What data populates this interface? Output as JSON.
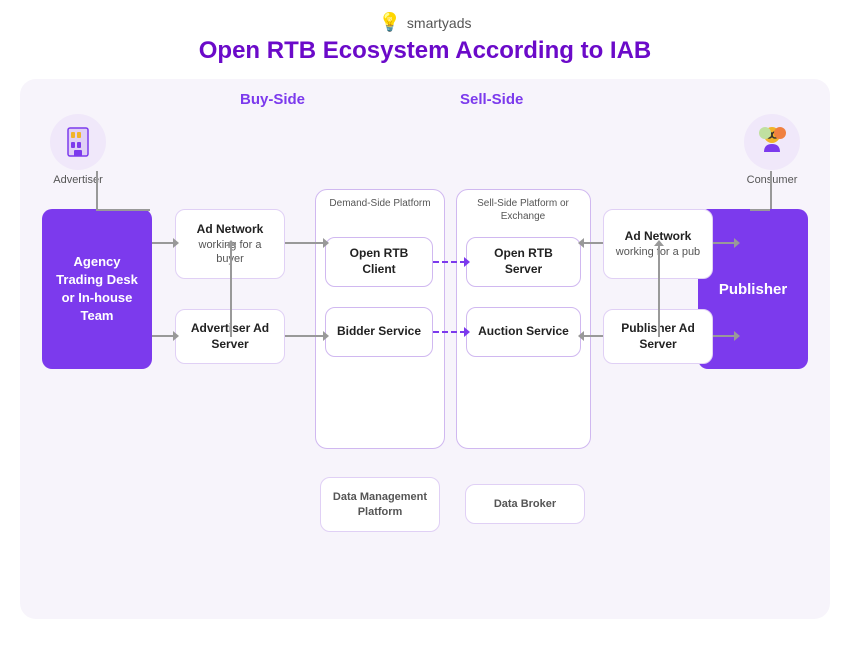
{
  "logo": {
    "text": "smartyads",
    "icon": "💡"
  },
  "title": "Open RTB Ecosystem According to IAB",
  "sections": {
    "buy_side": "Buy-Side",
    "sell_side": "Sell-Side"
  },
  "advertiser": {
    "label": "Advertiser"
  },
  "consumer": {
    "label": "Consumer"
  },
  "agency_box": {
    "text": "Agency Trading Desk or In-house Team"
  },
  "publisher_box": {
    "text": "Publisher"
  },
  "dsp_label": "Demand-Side Platform",
  "ssp_label": "Sell-Side Platform or Exchange",
  "boxes": {
    "ad_network_buyer": {
      "title": "Ad Network",
      "sub": "working for a buyer"
    },
    "advertiser_ad_server": {
      "title": "Advertiser Ad Server",
      "sub": ""
    },
    "open_rtb_client": {
      "title": "Open RTB Client",
      "sub": ""
    },
    "bidder_service": {
      "title": "Bidder Service",
      "sub": ""
    },
    "data_management_platform": {
      "title": "Data Management Platform",
      "sub": ""
    },
    "open_rtb_server": {
      "title": "Open RTB Server",
      "sub": ""
    },
    "auction_service": {
      "title": "Auction Service",
      "sub": ""
    },
    "data_broker": {
      "title": "Data Broker",
      "sub": ""
    },
    "ad_network_pub": {
      "title": "Ad Network",
      "sub": "working for a pub"
    },
    "publisher_ad_server": {
      "title": "Publisher Ad Server",
      "sub": ""
    }
  }
}
